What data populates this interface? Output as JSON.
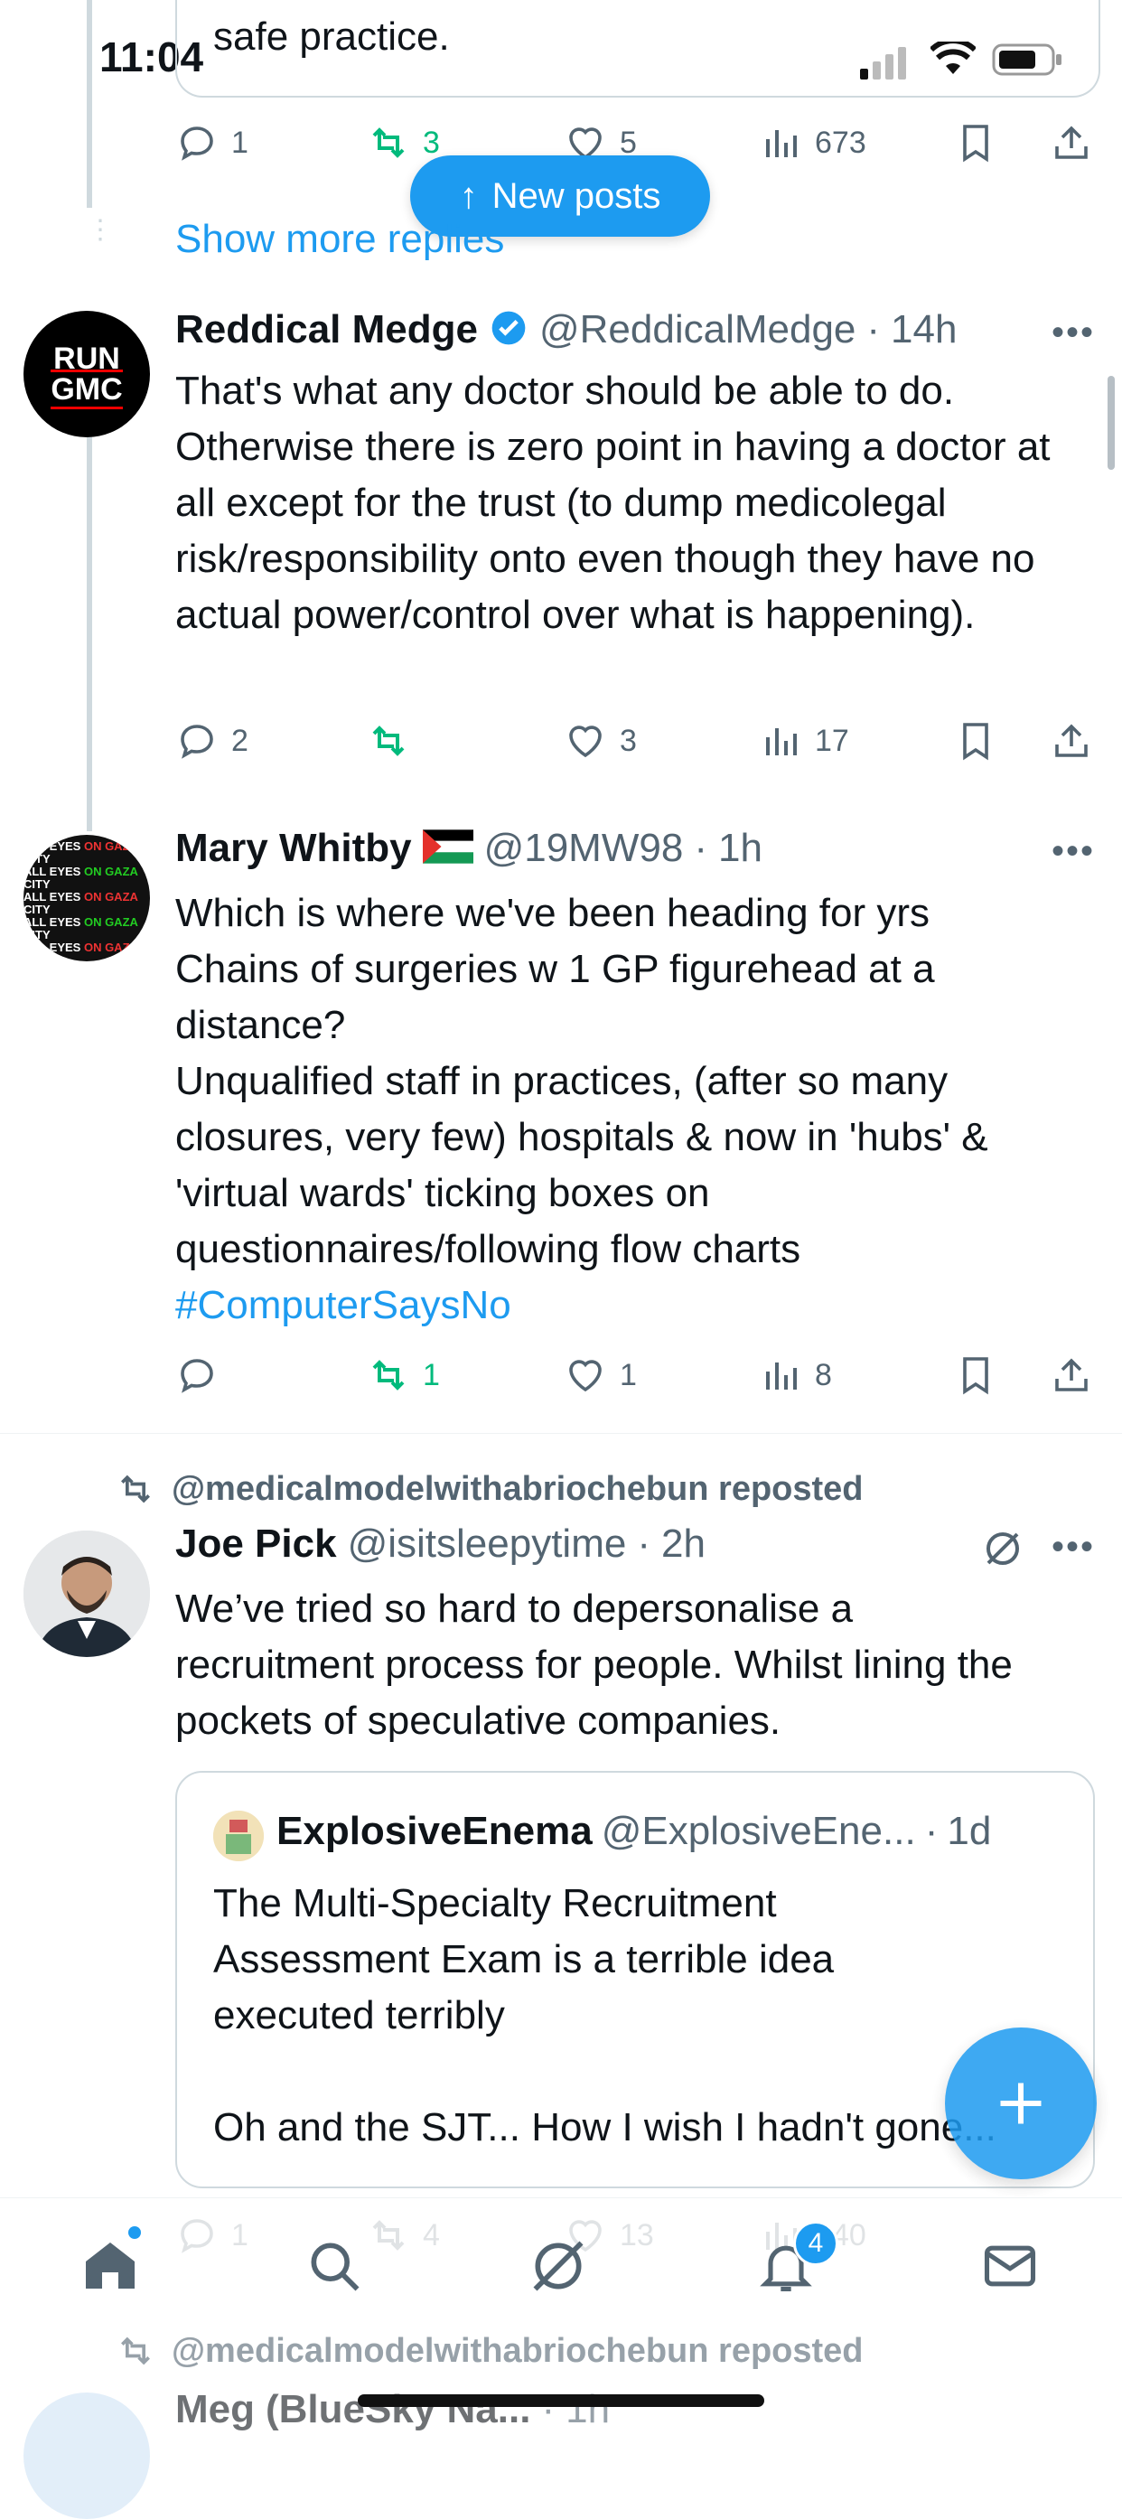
{
  "status_bar": {
    "time": "11:04"
  },
  "prev_tweet": {
    "text_tail": "safe practice.",
    "replies": "1",
    "reposts": "3",
    "likes": "5",
    "views": "673"
  },
  "new_posts_label": "New posts",
  "show_more_replies": "Show more replies",
  "tweets": [
    {
      "avatar_text": "RUN\nGMC",
      "name": "Reddical Medge",
      "handle": "@ReddicalMedge",
      "time": "14h",
      "text": "That's what any doctor should be able to do. Otherwise there is zero point in having a doctor at all except for the trust (to dump medicolegal risk/responsibility onto even though they have no actual power/control over what is happening).",
      "replies": "2",
      "reposts": "",
      "likes": "3",
      "views": "17"
    },
    {
      "avatar_text": "ALL EYES ON GAZA CITY",
      "name": "Mary Whitby",
      "handle": "@19MW98",
      "time": "1h",
      "text_lines": [
        "Which is where we've been heading for yrs",
        "Chains of surgeries w 1 GP figurehead at a",
        "distance?",
        "Unqualified staff in practices, (after so many",
        "closures, very few) hospitals & now in 'hubs' &",
        "'virtual wards' ticking boxes on",
        "questionnaires/following flow charts"
      ],
      "hashtag": "#ComputerSaysNo",
      "replies": "",
      "reposts": "1",
      "likes": "1",
      "views": "8"
    }
  ],
  "repost_1": {
    "reposted_by": "@medicalmodelwithabriochebun reposted",
    "name": "Joe Pick",
    "handle": "@isitsleepytime",
    "time": "2h",
    "text": "We’ve tried so hard to depersonalise a recruitment process for people. Whilst lining the pockets of speculative companies.",
    "quote": {
      "name": "ExplosiveEnema",
      "handle": "@ExplosiveEne...",
      "time": "1d",
      "text": "The Multi-Specialty Recruitment Assessment Exam is a terrible idea executed terribly",
      "text2": "Oh and the SJT... How I wish I hadn't gone..."
    },
    "replies": "1",
    "reposts": "4",
    "likes": "13",
    "views": "640"
  },
  "repost_2": {
    "reposted_by": "@medicalmodelwithabriochebun reposted",
    "name": "Meg",
    "handle": "(BlueSky Na...",
    "time": "1h"
  },
  "nav": {
    "notification_badge": "4"
  },
  "colors": {
    "accent": "#1d9bf0",
    "repost": "#00ba7c",
    "muted": "#536471"
  }
}
